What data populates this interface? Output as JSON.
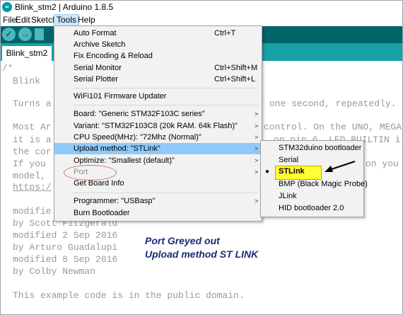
{
  "window": {
    "title": "Blink_stm2 | Arduino 1.8.5",
    "app_icon": "arduino-logo-icon"
  },
  "menubar": {
    "items": [
      "File",
      "Edit",
      "Sketch",
      "Tools",
      "Help"
    ],
    "active": "Tools"
  },
  "tabs": [
    {
      "label": "Blink_stm2"
    }
  ],
  "editor": {
    "lines": [
      "/*",
      "Blink",
      "",
      "Turns a",
      "",
      "Most Ar",
      "it is a",
      "the cor",
      "If you",
      "model,",
      "https:/",
      "",
      "modifie",
      "by Scott Fitzgerald",
      "modified 2 Sep 2016",
      "by Arturo Guadalupi",
      "modified 8 Sep 2016",
      "by Colby Newman",
      "",
      "This example code is in the public domain."
    ],
    "right_fragments": [
      "one second, repeatedly.",
      "control. On the UNO, MEGA",
      "on pin 6. LED_BUILTIN i",
      "on you"
    ]
  },
  "tools_menu": {
    "items": [
      {
        "label": "Auto Format",
        "shortcut": "Ctrl+T"
      },
      {
        "label": "Archive Sketch"
      },
      {
        "label": "Fix Encoding & Reload"
      },
      {
        "label": "Serial Monitor",
        "shortcut": "Ctrl+Shift+M"
      },
      {
        "label": "Serial Plotter",
        "shortcut": "Ctrl+Shift+L"
      },
      {
        "label": "WiFi101 Firmware Updater"
      },
      {
        "label": "Board: \"Generic STM32F103C series\"",
        "submenu": true
      },
      {
        "label": "Variant: \"STM32F103C8 (20k RAM. 64k Flash)\"",
        "submenu": true
      },
      {
        "label": "CPU Speed(MHz): \"72Mhz (Normal)\"",
        "submenu": true
      },
      {
        "label": "Upload method: \"STLink\"",
        "submenu": true,
        "highlighted": true
      },
      {
        "label": "Optimize: \"Smallest (default)\"",
        "submenu": true
      },
      {
        "label": "Port",
        "submenu": true,
        "disabled": true
      },
      {
        "label": "Get Board Info"
      },
      {
        "label": "Programmer: \"USBasp\"",
        "submenu": true
      },
      {
        "label": "Burn Bootloader"
      }
    ],
    "arrow_glyph": ">"
  },
  "upload_submenu": {
    "items": [
      {
        "label": "STM32duino bootloader"
      },
      {
        "label": "Serial"
      },
      {
        "label": "STLink",
        "selected": true
      },
      {
        "label": "BMP (Black Magic Probe)"
      },
      {
        "label": "JLink"
      },
      {
        "label": "HID bootloader 2.0"
      }
    ],
    "bullet_glyph": "●"
  },
  "annotations": {
    "line1": "Port Greyed out",
    "line2": "Upload method ST LINK"
  },
  "colors": {
    "toolbar": "#006468",
    "tabs_bar": "#17a1a5",
    "highlight": "#91c9f7",
    "annotation_text": "#1b2c7a",
    "stlink_highlight": "#ffff33",
    "port_circle": "#c8765a"
  }
}
